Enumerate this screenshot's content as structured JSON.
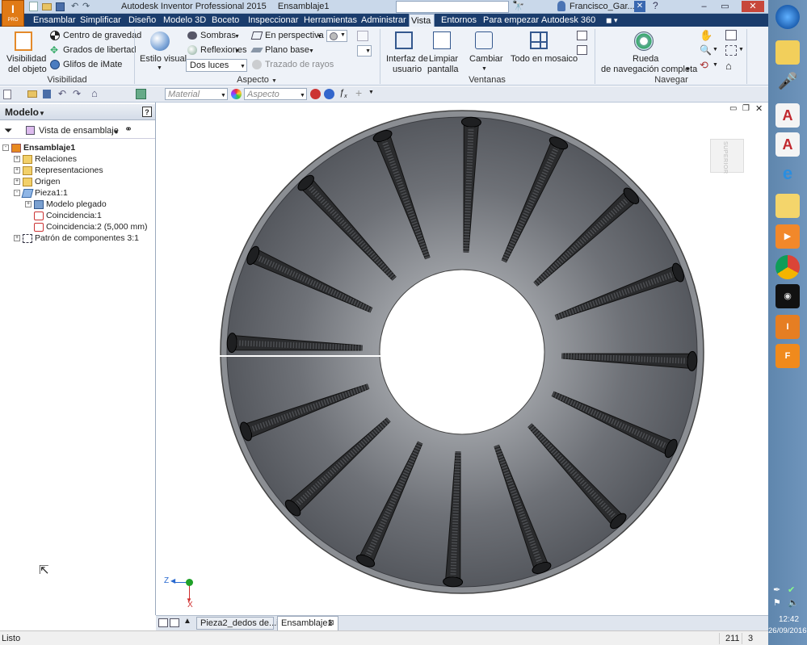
{
  "window": {
    "app_title": "Autodesk Inventor Professional 2015",
    "doc_title": "Ensamblaje1",
    "user": "Francisco_Gar...",
    "search_placeholder": ""
  },
  "tabs": [
    {
      "label": "Ensamblar",
      "active": false
    },
    {
      "label": "Simplificar",
      "active": false
    },
    {
      "label": "Diseño",
      "active": false
    },
    {
      "label": "Modelo 3D",
      "active": false
    },
    {
      "label": "Boceto",
      "active": false
    },
    {
      "label": "Inspeccionar",
      "active": false
    },
    {
      "label": "Herramientas",
      "active": false
    },
    {
      "label": "Administrar",
      "active": false
    },
    {
      "label": "Vista",
      "active": true
    },
    {
      "label": "Entornos",
      "active": false
    },
    {
      "label": "Para empezar",
      "active": false
    },
    {
      "label": "Autodesk 360",
      "active": false
    }
  ],
  "ribbon": {
    "visibilidad": {
      "title": "Visibilidad",
      "visibilidad_label_1": "Visibilidad",
      "visibilidad_label_2": "del objeto",
      "centro_gravedad": "Centro de gravedad",
      "grados_libertad": "Grados de libertad",
      "glifos_imate": "Glifos de iMate"
    },
    "aspecto": {
      "title": "Aspecto",
      "estilo_visual": "Estilo visual",
      "sombras": "Sombras",
      "reflexiones": "Reflexiones",
      "luces_value": "Dos luces",
      "en_perspectiva": "En perspectiva",
      "plano_base": "Plano base",
      "trazado_rayos": "Trazado de rayos"
    },
    "ventanas": {
      "title": "Ventanas",
      "interfaz_1": "Interfaz de",
      "interfaz_2": "usuario",
      "limpiar_1": "Limpiar",
      "limpiar_2": "pantalla",
      "cambiar": "Cambiar",
      "mosaico": "Todo en mosaico"
    },
    "navegar": {
      "title": "Navegar",
      "rueda_1": "Rueda",
      "rueda_2": "de navegación completa"
    }
  },
  "qat": {
    "material_value": "Material",
    "aspecto_value": "Aspecto"
  },
  "browser": {
    "title": "Modelo",
    "view_label": "Vista de ensamblaje",
    "tree": [
      {
        "label": "Ensamblaje1",
        "level": 0,
        "bold": true,
        "icon": "assembly-icon",
        "expander": "-"
      },
      {
        "label": "Relaciones",
        "level": 1,
        "bold": false,
        "icon": "folder-icon",
        "expander": "+"
      },
      {
        "label": "Representaciones",
        "level": 1,
        "bold": false,
        "icon": "folder-icon",
        "expander": "+"
      },
      {
        "label": "Origen",
        "level": 1,
        "bold": false,
        "icon": "folder-icon",
        "expander": "+"
      },
      {
        "label": "Pieza1:1",
        "level": 1,
        "bold": false,
        "icon": "part-icon",
        "expander": "-"
      },
      {
        "label": "Modelo plegado",
        "level": 2,
        "bold": false,
        "icon": "folded-model-icon",
        "expander": "+"
      },
      {
        "label": "Coincidencia:1",
        "level": 2,
        "bold": false,
        "icon": "mate-icon",
        "expander": ""
      },
      {
        "label": "Coincidencia:2 (5,000 mm)",
        "level": 2,
        "bold": false,
        "icon": "mate-icon",
        "expander": ""
      },
      {
        "label": "Patrón de componentes 3:1",
        "level": 1,
        "bold": false,
        "icon": "pattern-icon",
        "expander": "+"
      }
    ]
  },
  "viewport": {
    "viewcube_label": "SUPERIOR",
    "axis_z": "Z",
    "axis_x": "X",
    "colors": {
      "bowl": "#6e7177",
      "rim": "#8b8e93",
      "teeth": "#2a2b2d",
      "hole": "#ffffff"
    }
  },
  "doc_tabs": [
    {
      "label": "Pieza2_dedos de...ipt",
      "active": false
    },
    {
      "label": "Ensamblaje1",
      "active": true
    }
  ],
  "status": {
    "text": "Listo",
    "count_a": "211",
    "count_b": "3"
  },
  "taskbar": {
    "time": "12:42",
    "date": "26/09/2016",
    "icons": [
      "windows-start-icon",
      "notes-icon",
      "microphone-icon",
      "autocad-icon",
      "autocad-red-icon",
      "internet-explorer-icon",
      "file-explorer-icon",
      "media-player-icon",
      "chrome-icon",
      "audio-icon",
      "inventor-pro-icon",
      "fusion-icon"
    ]
  }
}
